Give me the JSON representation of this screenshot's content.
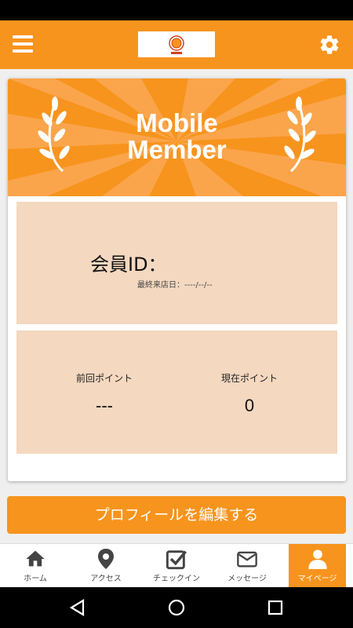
{
  "header": {
    "menu_icon": "hamburger-menu-icon",
    "settings_icon": "gear-icon",
    "logo": "shop-logo"
  },
  "banner": {
    "title_line1": "Mobile",
    "title_line2": "Member",
    "accent_color": "#f7941d"
  },
  "member": {
    "id_label": "会員ID：",
    "last_visit_label": "最終来店日：",
    "last_visit_value": "----/--/--"
  },
  "points": {
    "previous_label": "前回ポイント",
    "previous_value": "---",
    "current_label": "現在ポイント",
    "current_value": "0"
  },
  "actions": {
    "edit_profile_label": "プロフィールを編集する"
  },
  "tabs": [
    {
      "label": "ホーム",
      "icon": "home-icon"
    },
    {
      "label": "アクセス",
      "icon": "map-pin-icon"
    },
    {
      "label": "チェックイン",
      "icon": "checkin-icon"
    },
    {
      "label": "メッセージ",
      "icon": "mail-icon"
    },
    {
      "label": "マイページ",
      "icon": "user-icon",
      "active": true
    }
  ],
  "system_nav": {
    "back_icon": "back-triangle-icon",
    "home_icon": "home-circle-icon",
    "recents_icon": "recents-square-icon"
  }
}
